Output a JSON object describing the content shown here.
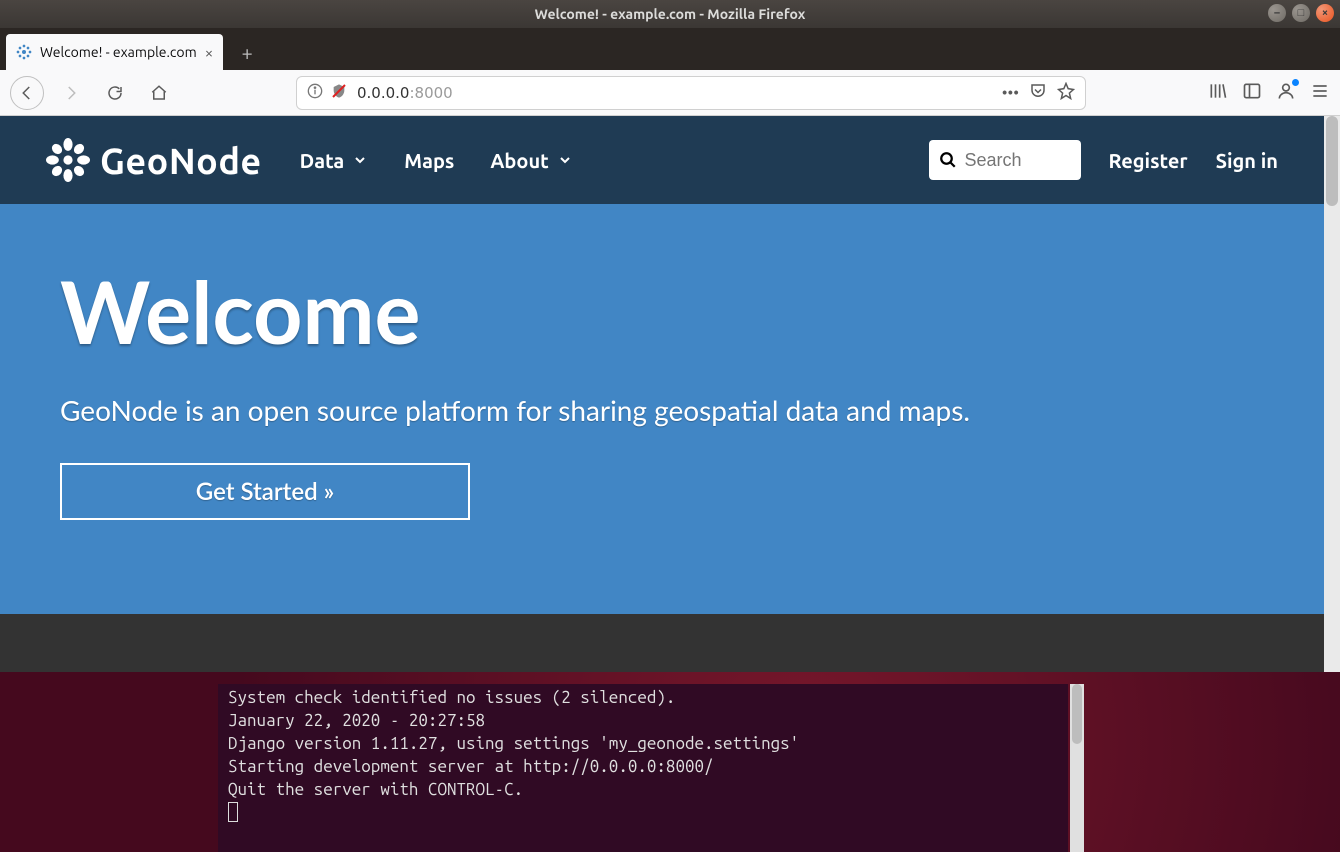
{
  "window": {
    "title": "Welcome! - example.com - Mozilla Firefox"
  },
  "tab": {
    "title": "Welcome! - example.com"
  },
  "nav": {
    "url_host": "0.0.0.0",
    "url_port": ":8000"
  },
  "site": {
    "brand": "GeoNode",
    "menu": {
      "data": "Data",
      "maps": "Maps",
      "about": "About"
    },
    "search_placeholder": "Search",
    "register": "Register",
    "signin": "Sign in"
  },
  "hero": {
    "title": "Welcome",
    "subtitle": "GeoNode is an open source platform for sharing geospatial data and maps.",
    "cta": "Get Started »"
  },
  "terminal": {
    "line1": "System check identified no issues (2 silenced).",
    "line2": "January 22, 2020 - 20:27:58",
    "line3": "Django version 1.11.27, using settings 'my_geonode.settings'",
    "line4": "Starting development server at http://0.0.0.0:8000/",
    "line5": "Quit the server with CONTROL-C."
  }
}
